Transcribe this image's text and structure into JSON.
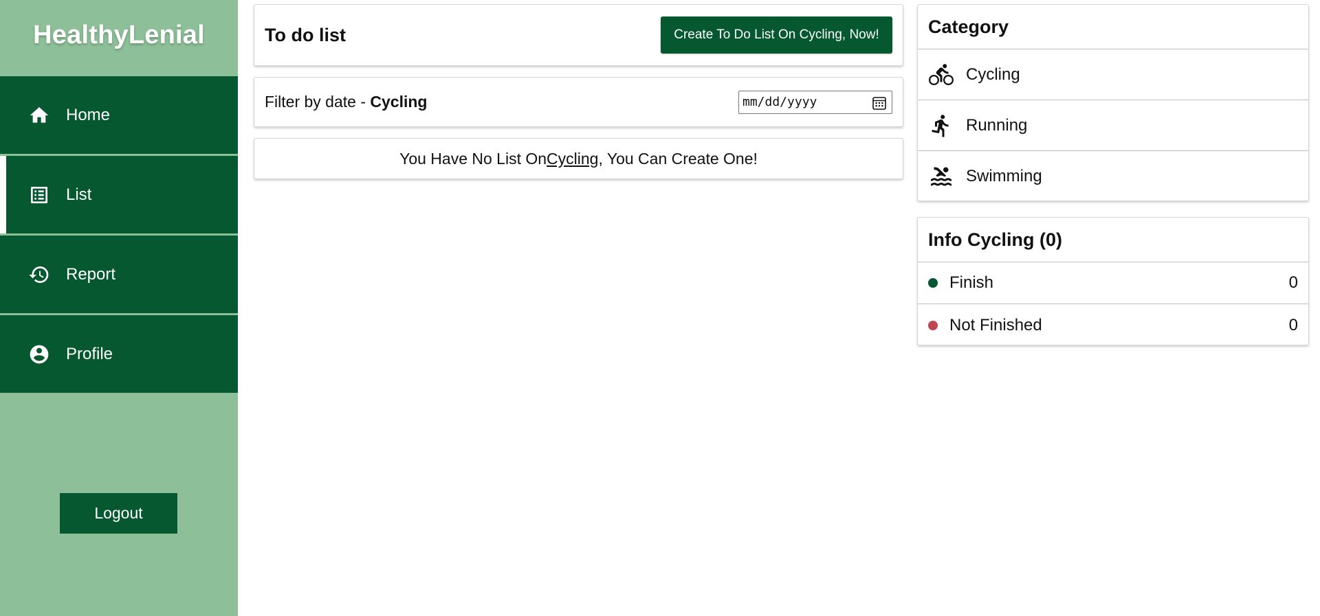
{
  "brand": "HealthyLenial",
  "sidebar": {
    "items": [
      {
        "label": "Home",
        "icon": "home-icon"
      },
      {
        "label": "List",
        "icon": "list-icon",
        "active": true
      },
      {
        "label": "Report",
        "icon": "history-icon"
      },
      {
        "label": "Profile",
        "icon": "account-circle-icon"
      }
    ],
    "logout_label": "Logout"
  },
  "todo": {
    "title": "To do list",
    "create_button": "Create To Do List On Cycling, Now!"
  },
  "filter": {
    "label_prefix": "Filter by date - ",
    "label_category": "Cycling",
    "date_placeholder": "mm/dd/yyyy"
  },
  "empty_message": {
    "before": "You Have No List On ",
    "category": "Cycling",
    "after": ", You Can Create One!"
  },
  "category": {
    "title": "Category",
    "items": [
      {
        "label": "Cycling",
        "icon": "bike-icon"
      },
      {
        "label": "Running",
        "icon": "run-icon"
      },
      {
        "label": "Swimming",
        "icon": "swim-icon"
      }
    ]
  },
  "info": {
    "title": "Info Cycling (0)",
    "rows": [
      {
        "label": "Finish",
        "count": "0",
        "color": "#05582f"
      },
      {
        "label": "Not Finished",
        "count": "0",
        "color": "#c0474f"
      }
    ]
  },
  "colors": {
    "sidebar_bg": "#8dbf98",
    "accent": "#05582f"
  }
}
